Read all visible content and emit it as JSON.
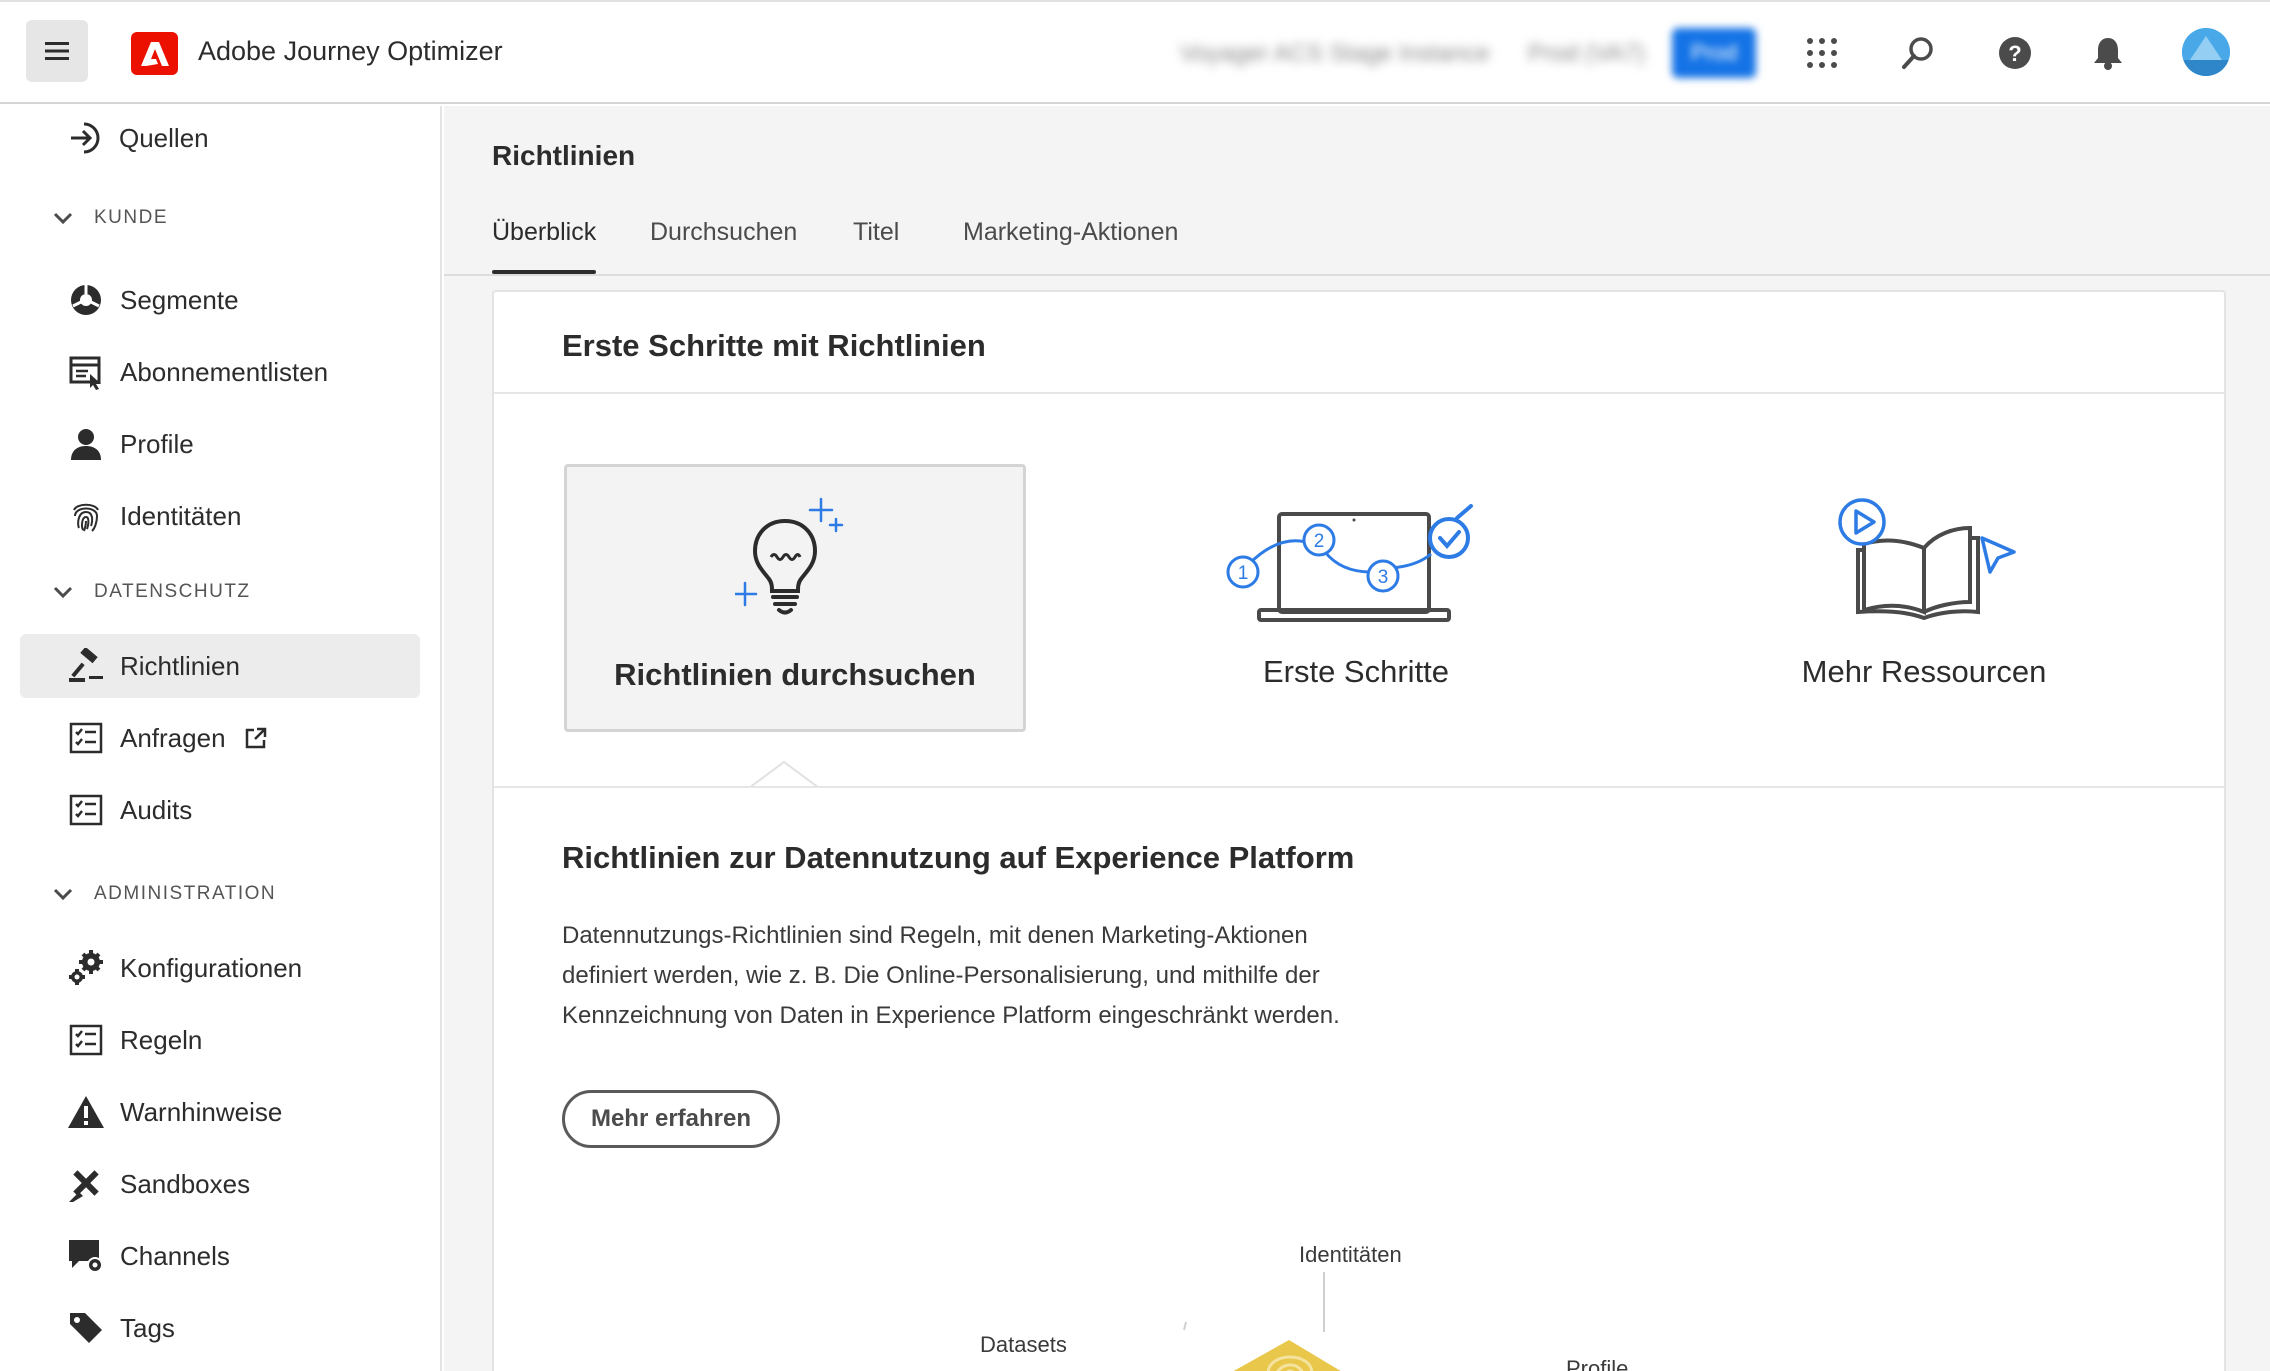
{
  "header": {
    "app_title": "Adobe Journey Optimizer",
    "org_name": "Voyager ACS Stage Instance",
    "sandbox_name": "Prod (VA7)",
    "env_badge": "Prod",
    "icons": [
      "hamburger-icon",
      "adobe-logo",
      "app-grid-icon",
      "search-icon",
      "help-icon",
      "bell-icon",
      "avatar"
    ]
  },
  "sidebar": {
    "top_item": {
      "label": "Quellen",
      "icon": "sources-icon"
    },
    "sections": [
      {
        "label": "KUNDE",
        "items": [
          {
            "label": "Segmente",
            "icon": "segments-icon"
          },
          {
            "label": "Abonnementlisten",
            "icon": "subscription-lists-icon"
          },
          {
            "label": "Profile",
            "icon": "profile-icon"
          },
          {
            "label": "Identitäten",
            "icon": "fingerprint-icon"
          }
        ]
      },
      {
        "label": "DATENSCHUTZ",
        "items": [
          {
            "label": "Richtlinien",
            "icon": "gavel-icon",
            "active": true
          },
          {
            "label": "Anfragen",
            "icon": "checklist-icon",
            "external": true
          },
          {
            "label": "Audits",
            "icon": "checklist-icon"
          }
        ]
      },
      {
        "label": "ADMINISTRATION",
        "items": [
          {
            "label": "Konfigurationen",
            "icon": "gears-icon"
          },
          {
            "label": "Regeln",
            "icon": "checklist-icon"
          },
          {
            "label": "Warnhinweise",
            "icon": "alert-icon"
          },
          {
            "label": "Sandboxes",
            "icon": "sandbox-icon"
          },
          {
            "label": "Channels",
            "icon": "channels-icon"
          },
          {
            "label": "Tags",
            "icon": "tag-icon"
          }
        ]
      }
    ]
  },
  "main": {
    "page_title": "Richtlinien",
    "tabs": [
      {
        "label": "Überblick",
        "active": true
      },
      {
        "label": "Durchsuchen"
      },
      {
        "label": "Titel"
      },
      {
        "label": "Marketing-Aktionen"
      }
    ],
    "card": {
      "title": "Erste Schritte mit Richtlinien",
      "tiles": [
        {
          "label": "Richtlinien durchsuchen",
          "icon": "lightbulb-icon",
          "selected": true
        },
        {
          "label": "Erste Schritte",
          "icon": "laptop-steps-icon"
        },
        {
          "label": "Mehr Ressourcen",
          "icon": "book-resources-icon"
        }
      ],
      "section_title": "Richtlinien zur Datennutzung auf Experience Platform",
      "section_desc": "Datennutzungs-Richtlinien sind Regeln, mit denen Marketing-Aktionen definiert werden, wie z. B. Die Online-Personalisierung, und mithilfe der Kennzeichnung von Daten in Experience Platform eingeschränkt werden.",
      "learn_more": "Mehr erfahren",
      "diagram_labels": {
        "identities": "Identitäten",
        "datasets": "Datasets",
        "profile": "Profile"
      }
    }
  },
  "colors": {
    "accent_blue": "#1473e6",
    "adobe_red": "#eb1000",
    "illustration_blue": "#2d7be5",
    "diagram_yellow": "#e9c74a"
  }
}
